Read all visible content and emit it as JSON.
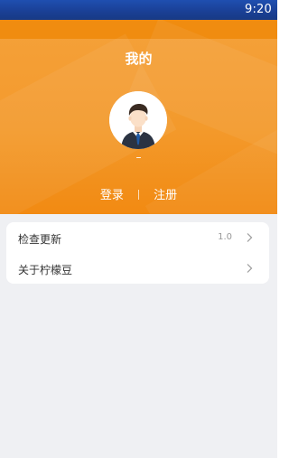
{
  "status_bar": {
    "time": "9:20"
  },
  "header": {
    "title": "我的",
    "nickname": "–",
    "login_label": "登录",
    "register_label": "注册"
  },
  "menu": {
    "items": [
      {
        "label": "检查更新",
        "value": "1.0",
        "icon": "chevron-right-icon"
      },
      {
        "label": "关于柠檬豆",
        "value": "",
        "icon": "chevron-right-icon"
      }
    ]
  },
  "colors": {
    "status_bar": "#1a3f94",
    "header_orange": "#f39a2c",
    "background": "#eff0f3"
  }
}
